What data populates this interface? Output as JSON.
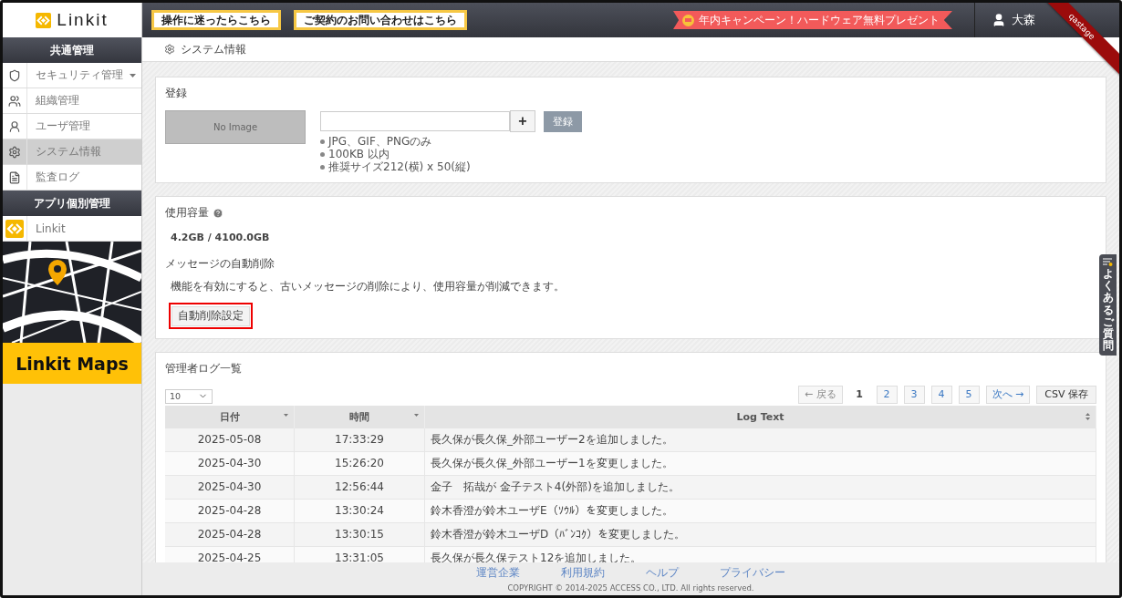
{
  "header": {
    "logo": "Linkit",
    "help_buttons": [
      "操作に迷ったらこちら",
      "ご契約のお問い合わせはこちら"
    ],
    "campaign": "年内キャンペーン！ハードウェア無料プレゼント",
    "user": "大森",
    "ribbon": "qastage"
  },
  "sidebar": {
    "sections": [
      {
        "title": "共通管理",
        "items": [
          {
            "label": "セキュリティ管理",
            "selected": false,
            "expandable": true
          },
          {
            "label": "組織管理",
            "selected": false,
            "expandable": false
          },
          {
            "label": "ユーザ管理",
            "selected": false,
            "expandable": false
          },
          {
            "label": "システム情報",
            "selected": true,
            "expandable": false
          },
          {
            "label": "監査ログ",
            "selected": false,
            "expandable": false
          }
        ]
      },
      {
        "title": "アプリ個別管理",
        "items": [
          {
            "label": "Linkit",
            "selected": false,
            "expandable": false
          }
        ]
      }
    ],
    "banner": {
      "title": "Linkit Maps"
    }
  },
  "page_title": "システム情報",
  "register": {
    "title": "登録",
    "preview": "No Image",
    "add": "+",
    "submit": "登録",
    "notes": [
      "JPG、GIF、PNGのみ",
      "100KB 以内",
      "推奨サイズ212(横) x 50(縦)"
    ]
  },
  "usage": {
    "title": "使用容量",
    "value": "4.2GB / 4100.0GB",
    "auto_delete_title": "メッセージの自動削除",
    "description": "機能を有効にすると、古いメッセージの削除により、使用容量が削減できます。",
    "button": "自動削除設定"
  },
  "log": {
    "title": "管理者ログ一覧",
    "page_size": "10",
    "pagination": [
      {
        "label": "← 戻る",
        "selected": false,
        "disabled": true
      },
      {
        "label": "1",
        "selected": true,
        "disabled": false
      },
      {
        "label": "2",
        "selected": false,
        "disabled": false
      },
      {
        "label": "3",
        "selected": false,
        "disabled": false
      },
      {
        "label": "4",
        "selected": false,
        "disabled": false
      },
      {
        "label": "5",
        "selected": false,
        "disabled": false
      },
      {
        "label": "次へ →",
        "selected": false,
        "disabled": false
      }
    ],
    "csv": "CSV 保存",
    "columns": [
      {
        "label": "日付",
        "sorted": true
      },
      {
        "label": "時間",
        "sorted": true
      },
      {
        "label": "Log Text",
        "sorted": false
      }
    ],
    "rows": [
      [
        "2025-05-08",
        "17:33:29",
        "長久保が長久保_外部ユーザー2を追加しました。"
      ],
      [
        "2025-04-30",
        "15:26:20",
        "長久保が長久保_外部ユーザー1を変更しました。"
      ],
      [
        "2025-04-30",
        "12:56:44",
        "金子　拓哉が 金子テスト4(外部)を追加しました。"
      ],
      [
        "2025-04-28",
        "13:30:24",
        "鈴木香澄が鈴木ユーザE（ｿｳﾙ）を変更しました。"
      ],
      [
        "2025-04-28",
        "13:30:15",
        "鈴木香澄が鈴木ユーザD（ﾊﾞﾝｺｸ）を変更しました。"
      ],
      [
        "2025-04-25",
        "13:31:05",
        "長久保が長久保テスト12を追加しました。"
      ]
    ]
  },
  "faq": "よくあるご質問",
  "footer": {
    "links": [
      "運営企業",
      "利用規約",
      "ヘルプ",
      "プライバシー"
    ],
    "copyright": "COPYRIGHT © 2014-2025 ACCESS CO., LTD. All rights reserved."
  }
}
